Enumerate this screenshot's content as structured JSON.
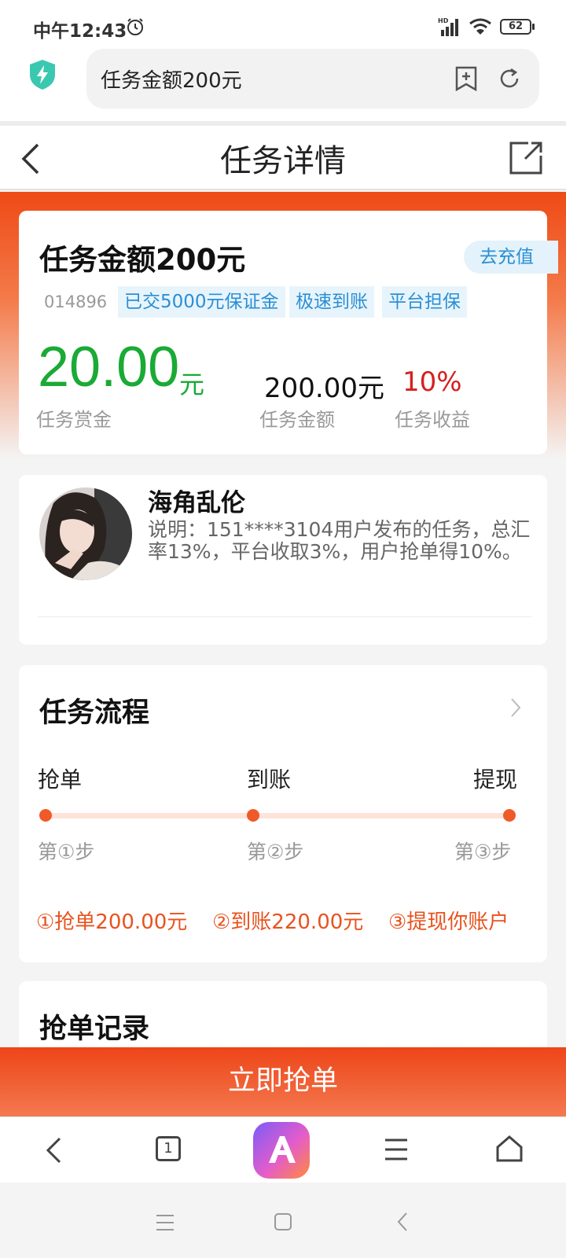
{
  "status_bar": {
    "time": "中午12:43",
    "battery": "62"
  },
  "browser": {
    "address_text": "任务金额200元"
  },
  "header": {
    "title": "任务详情"
  },
  "task": {
    "title": "任务金额200元",
    "recharge_label": "去充值",
    "id": "014896",
    "tags": [
      "已交5000元保证金",
      "极速到账",
      "平台担保"
    ],
    "reward_value": "20.00",
    "reward_unit": "元",
    "reward_label": "任务赏金",
    "amount_value": "200.00元",
    "amount_label": "任务金额",
    "yield_value": "10%",
    "yield_label": "任务收益"
  },
  "user": {
    "name": "海角乱伦",
    "description": "说明：151****3104用户发布的任务，总汇率13%，平台收取3%，用户抢单得10%。"
  },
  "flow": {
    "title": "任务流程",
    "steps": [
      {
        "name": "抢单",
        "num": "第①步"
      },
      {
        "name": "到账",
        "num": "第②步"
      },
      {
        "name": "提现",
        "num": "第③步"
      }
    ],
    "notes": [
      "①抢单200.00元",
      "②到账220.00元",
      "③提现你账户"
    ]
  },
  "record": {
    "title": "抢单记录"
  },
  "action": {
    "grab_label": "立即抢单"
  },
  "bottom_nav": {
    "tab_count": "1"
  },
  "colors": {
    "accent": "#ee4a16",
    "green": "#1aaa35",
    "red": "#d62020",
    "blue": "#2a8fd4"
  }
}
